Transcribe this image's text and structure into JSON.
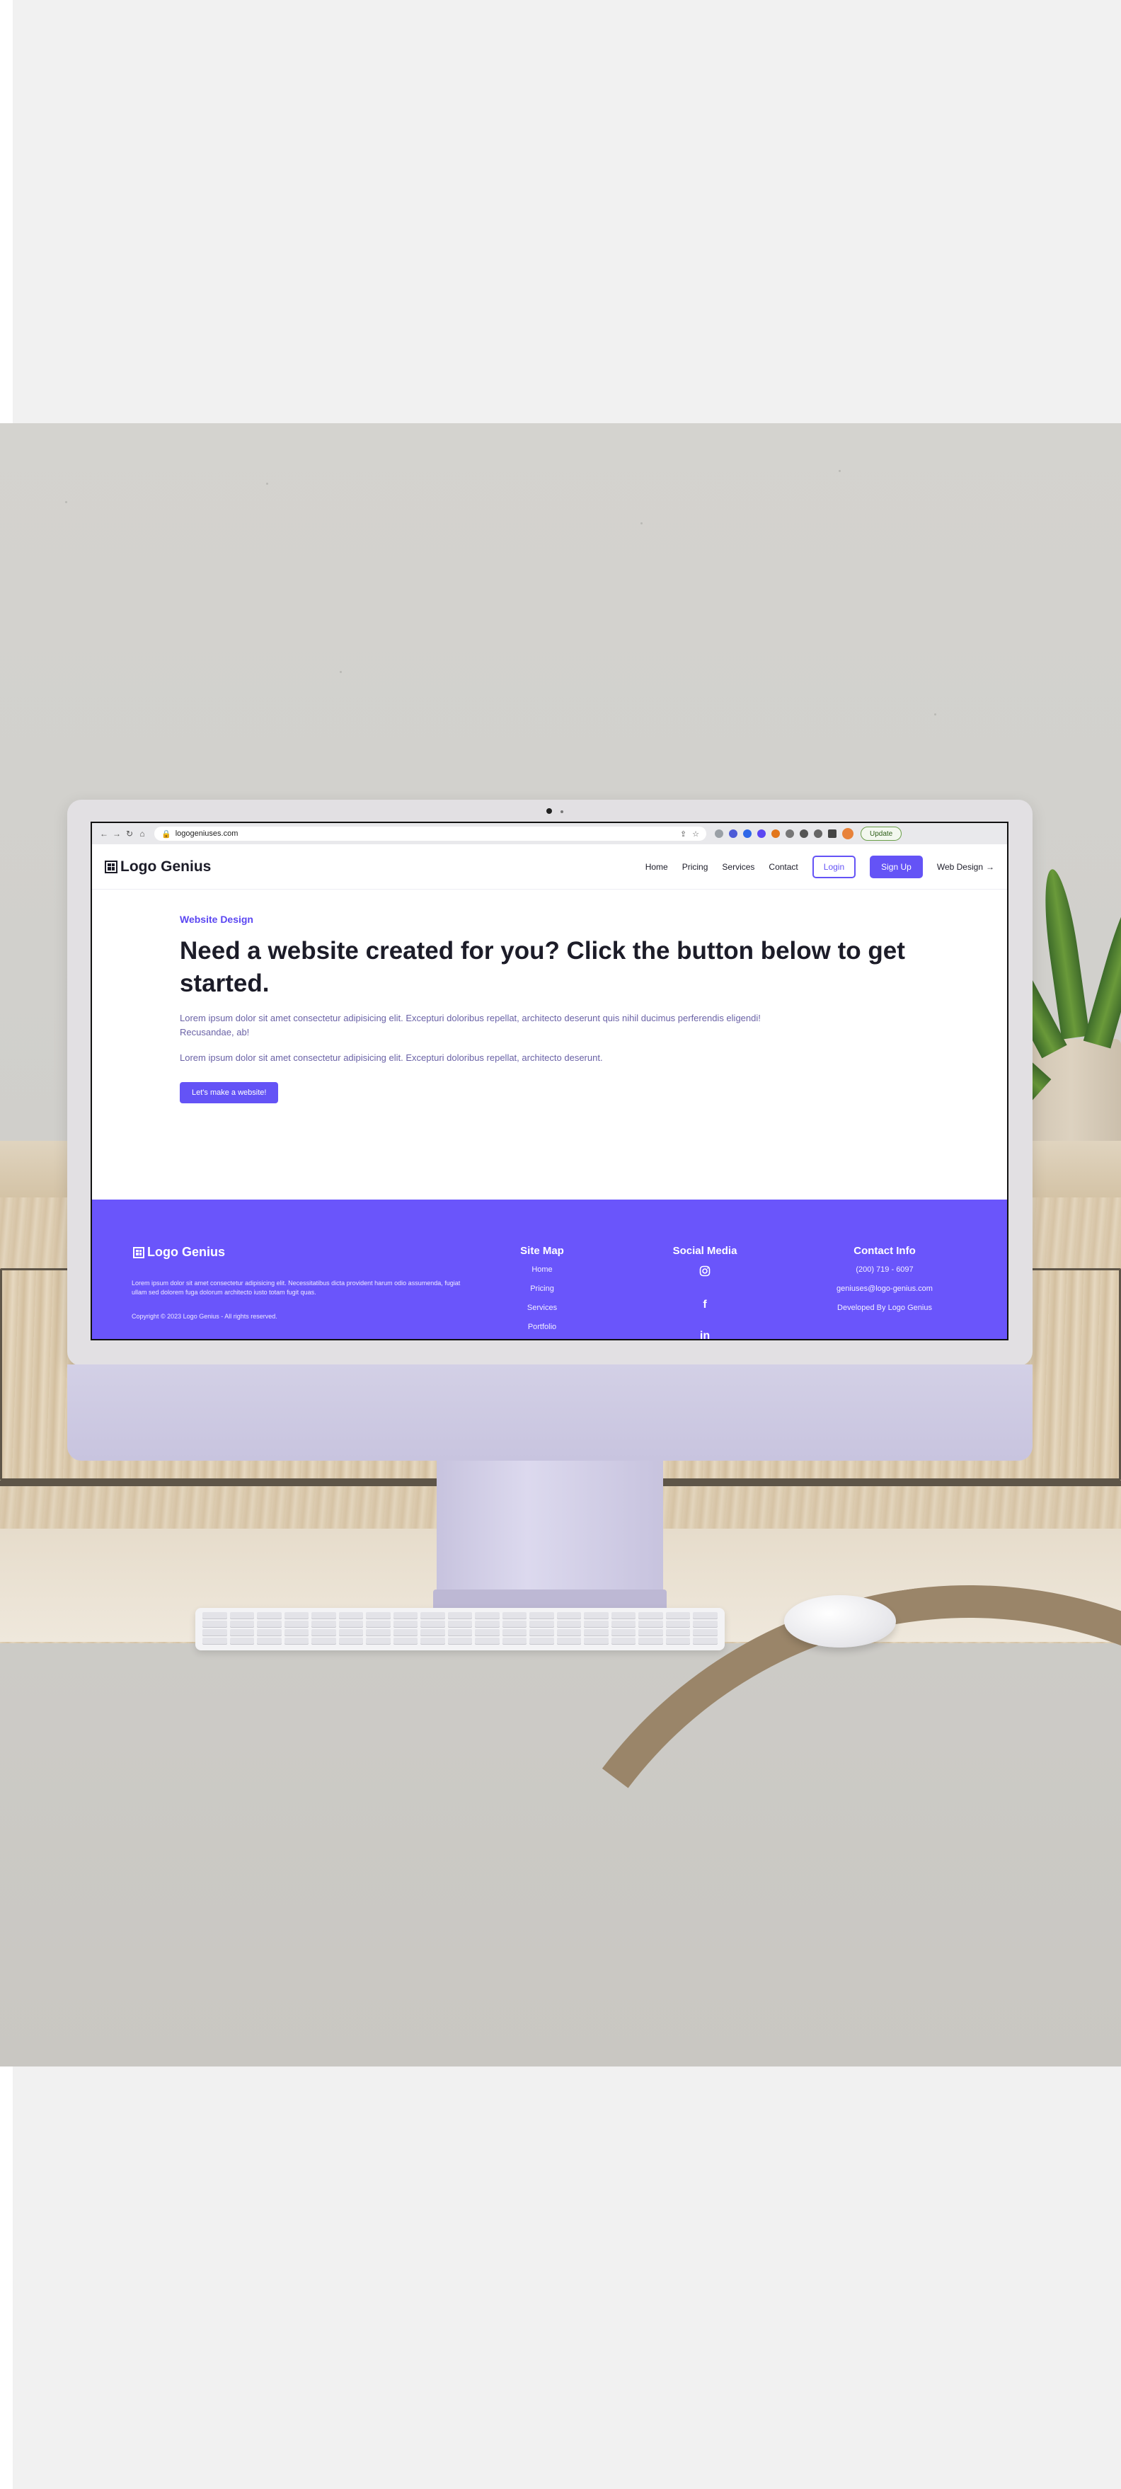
{
  "browser": {
    "url": "logogeniuses.com",
    "update_label": "Update"
  },
  "site": {
    "brand": "Logo Genius",
    "nav": {
      "home": "Home",
      "pricing": "Pricing",
      "services": "Services",
      "contact": "Contact",
      "login": "Login",
      "signup": "Sign Up",
      "web_design": "Web Design"
    },
    "hero": {
      "kicker": "Website Design",
      "headline": "Need a website created for you? Click the button below to get started.",
      "para1": "Lorem ipsum dolor sit amet consectetur adipisicing elit. Excepturi doloribus repellat, architecto deserunt quis nihil ducimus perferendis eligendi! Recusandae, ab!",
      "para2": "Lorem ipsum dolor sit amet consectetur adipisicing elit. Excepturi doloribus repellat, architecto deserunt.",
      "cta": "Let's make a website!"
    },
    "footer": {
      "brand": "Logo Genius",
      "about": "Lorem ipsum dolor sit amet consectetur adipisicing elit. Necessitatibus dicta provident harum odio assumenda, fugiat ullam sed dolorem fuga dolorum architecto iusto totam fugit quas.",
      "copyright": "Copyright © 2023 Logo Genius - All rights reserved.",
      "sitemap": {
        "title": "Site Map",
        "items": [
          "Home",
          "Pricing",
          "Services",
          "Portfolio"
        ]
      },
      "social": {
        "title": "Social Media",
        "icons": [
          "instagram-icon",
          "facebook-icon",
          "linkedin-icon"
        ]
      },
      "contact": {
        "title": "Contact Info",
        "phone": "(200) 719 - 6097",
        "email": "geniuses@logo-genius.com",
        "credit": "Developed By Logo Genius"
      }
    }
  },
  "colors": {
    "accent": "#6453f6",
    "footer_bg": "#6a55fb",
    "text_dark": "#1c1c28"
  }
}
